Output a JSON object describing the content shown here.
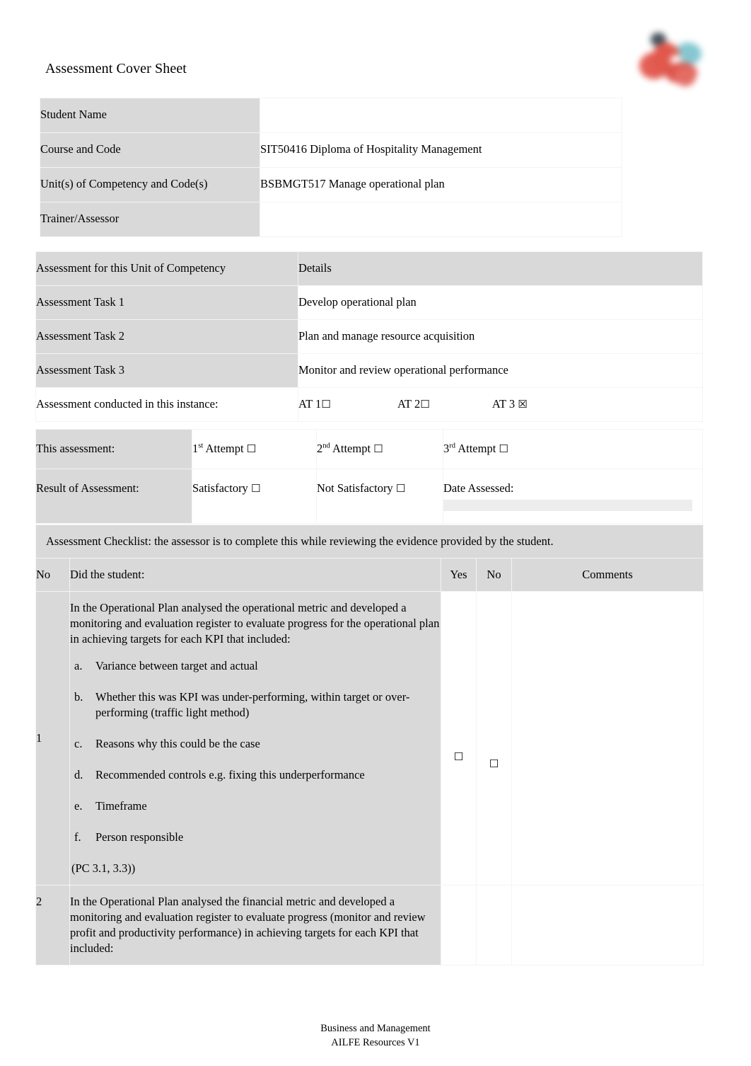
{
  "document": {
    "title": "Assessment Cover Sheet",
    "logo_icon": "ailfe-logo-icon"
  },
  "student_details": {
    "rows": [
      {
        "label": "Student Name",
        "value": ""
      },
      {
        "label": "Course and Code",
        "value": "SIT50416 Diploma of Hospitality Management"
      },
      {
        "label": "Unit(s) of Competency and Code(s)",
        "value": "BSBMGT517 Manage operational plan"
      },
      {
        "label": "Trainer/Assessor",
        "value": ""
      }
    ]
  },
  "assessment_tasks": {
    "header": {
      "col1": "Assessment for this Unit of Competency",
      "col2": "Details"
    },
    "rows": [
      {
        "label": "Assessment Task 1",
        "detail": "Develop operational plan"
      },
      {
        "label": "Assessment Task 2",
        "detail": "Plan and manage resource acquisition"
      },
      {
        "label": "Assessment Task 3",
        "detail": "Monitor and review operational performance"
      }
    ],
    "conducted": {
      "label": "Assessment conducted in this instance:",
      "options": [
        {
          "label": "AT 1",
          "box": "☐",
          "checked": false
        },
        {
          "label": "AT 2",
          "box": "☐",
          "checked": false
        },
        {
          "label": "AT 3",
          "box": "☒",
          "checked": true
        }
      ]
    }
  },
  "result_section": {
    "attempt_label": "This assessment:",
    "attempts": [
      {
        "number": "1",
        "ordinal": "st",
        "text": " Attempt",
        "box": "☐"
      },
      {
        "number": "2",
        "ordinal": "nd",
        "text": " Attempt",
        "box": "☐"
      },
      {
        "number": "3",
        "ordinal": "rd",
        "text": " Attempt",
        "box": "☐"
      }
    ],
    "result_label": "Result of Assessment:",
    "results": [
      {
        "label": "Satisfactory",
        "box": "☐"
      },
      {
        "label": "Not Satisfactory",
        "box": "☐"
      }
    ],
    "date_label": "Date Assessed:",
    "date_value": ""
  },
  "checklist": {
    "banner": "Assessment Checklist: the assessor is to complete this while reviewing the evidence provided by the student.",
    "headers": {
      "no": "No",
      "did": "Did the student:",
      "yes": "Yes",
      "no_col": "No",
      "comments": "Comments"
    },
    "rows": [
      {
        "no": "1",
        "intro": "In the Operational Plan analysed the  operational  metric and developed a monitoring and evaluation register to evaluate progress for the operational plan in achieving targets for each KPI that included:",
        "items": [
          {
            "marker": "a.",
            "text": "Variance between target and actual"
          },
          {
            "marker": "b.",
            "text": "Whether this was KPI was under-performing, within target or over-performing (traffic light method)"
          },
          {
            "marker": "c.",
            "text": "Reasons why this could be the case"
          },
          {
            "marker": "d.",
            "text": "Recommended controls e.g. fixing this underperformance"
          },
          {
            "marker": "e.",
            "text": "Timeframe"
          },
          {
            "marker": "f.",
            "text": "Person responsible"
          }
        ],
        "pc": "(PC 3.1, 3.3))",
        "yes_box": "☐",
        "no_box": "☐",
        "comments": ""
      },
      {
        "no": "2",
        "intro": "In the Operational Plan analysed the  financial metric and developed a monitoring and evaluation register to evaluate progress (monitor and review profit and productivity performance) in achieving targets for each KPI that included:",
        "items": [],
        "pc": "",
        "yes_box": "",
        "no_box": "",
        "comments": ""
      }
    ]
  },
  "footer": {
    "line1": "Business and Management",
    "line2": "AILFE Resources V1"
  },
  "colors": {
    "label_cell": "#d9d9d9",
    "value_cell": "#ffffff",
    "page_background": "#ffffff",
    "text": "#000000"
  }
}
